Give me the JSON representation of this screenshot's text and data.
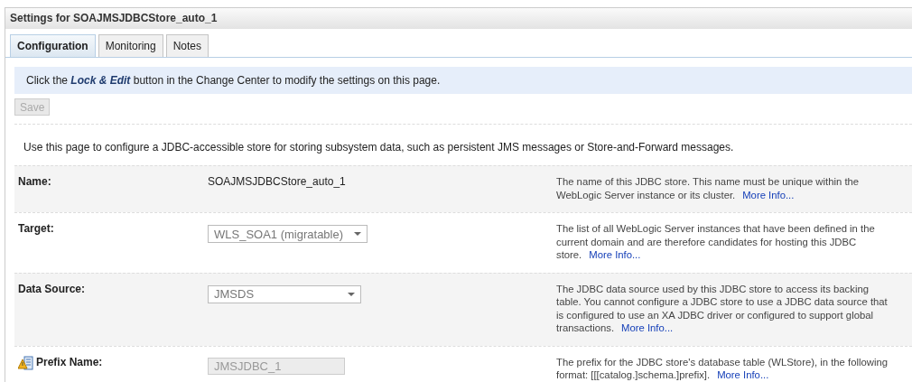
{
  "window": {
    "title": "Settings for SOAJMSJDBCStore_auto_1"
  },
  "tabs": [
    {
      "label": "Configuration",
      "selected": true
    },
    {
      "label": "Monitoring",
      "selected": false
    },
    {
      "label": "Notes",
      "selected": false
    }
  ],
  "notice": "Click the **Lock & Edit** button in the Change Center to modify the settings on this page.",
  "save_button": {
    "label": "Save",
    "disabled": true
  },
  "description": "Use this page to configure a JDBC-accessible store for storing subsystem data, such as persistent JMS messages or Store-and-Forward messages.",
  "fields": [
    {
      "kind": "text",
      "label": "Name:",
      "value": "SOAJMSJDBCStore_auto_1",
      "flagged": false,
      "help": "The name of this JDBC store. This name must be unique within the WebLogic Server instance or its cluster.",
      "link": "More Info..."
    },
    {
      "kind": "select",
      "label": "Target:",
      "value": "WLS_SOA1 (migratable)",
      "flagged": false,
      "help": "The list of all WebLogic Server instances that have been defined in the current domain and are therefore candidates for hosting this JDBC store.",
      "link": "More Info..."
    },
    {
      "kind": "select",
      "label": "Data Source:",
      "value": "JMSDS",
      "flagged": false,
      "help": "The JDBC data source used by this JDBC store to access its backing table. You cannot configure a JDBC store to use a JDBC data source that is configured to use an XA JDBC driver or configured to support global transactions.",
      "link": "More Info..."
    },
    {
      "kind": "input",
      "label": "Prefix Name:",
      "value": "JMSJDBC_1",
      "disabled": true,
      "flagged": true,
      "help": "The prefix for the JDBC store's database table (WLStore), in the following format: [[[catalog.]schema.]prefix].",
      "link": "More Info..."
    }
  ]
}
